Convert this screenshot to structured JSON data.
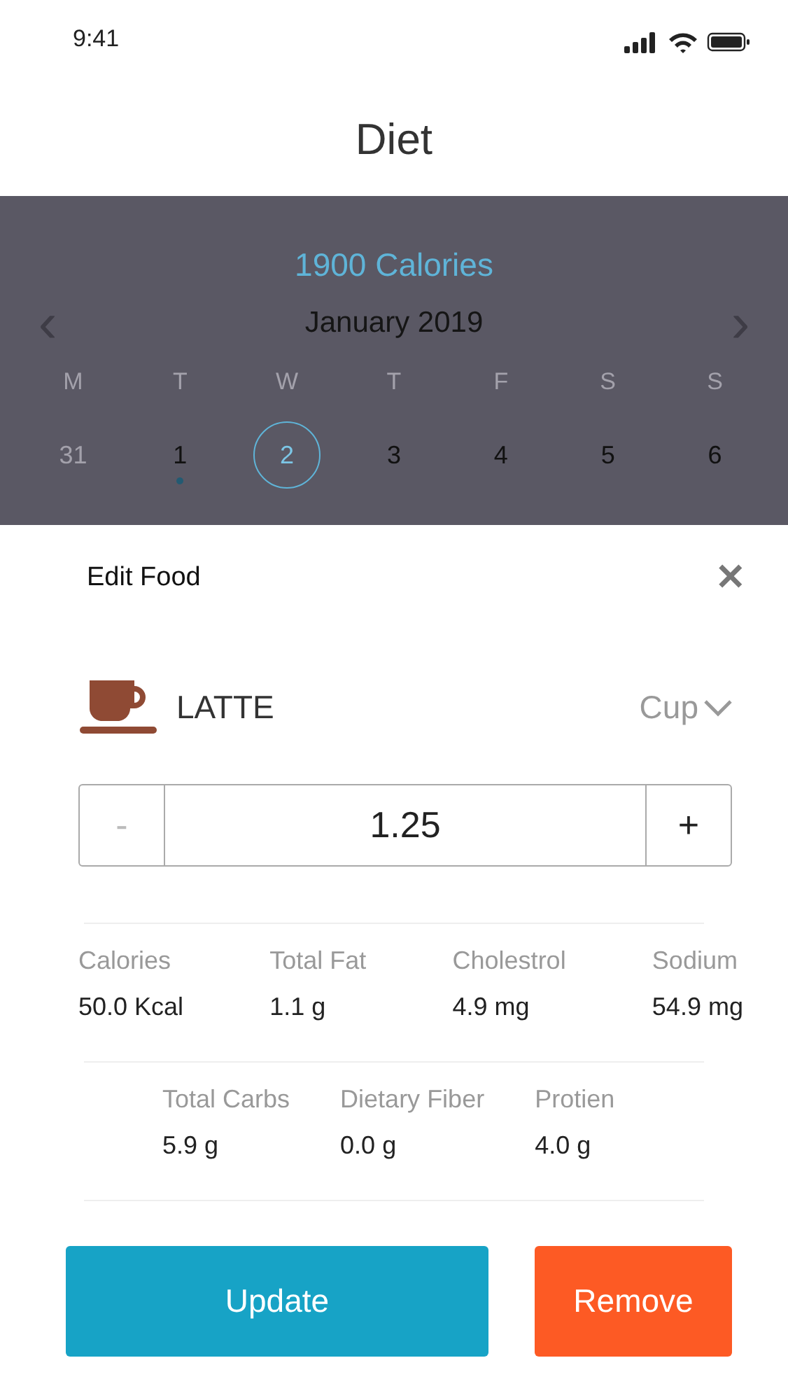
{
  "status_bar": {
    "time": "9:41"
  },
  "header": {
    "title": "Diet"
  },
  "calendar": {
    "calories": "1900 Calories",
    "month": "January 2019",
    "prev": "‹",
    "next": "›",
    "weekdays": [
      "M",
      "T",
      "W",
      "T",
      "F",
      "S",
      "S"
    ],
    "days": [
      {
        "label": "31",
        "selected": false,
        "outside_month": true,
        "has_entry": false
      },
      {
        "label": "1",
        "selected": false,
        "outside_month": false,
        "has_entry": true
      },
      {
        "label": "2",
        "selected": true,
        "outside_month": false,
        "has_entry": false
      },
      {
        "label": "3",
        "selected": false,
        "outside_month": false,
        "has_entry": false
      },
      {
        "label": "4",
        "selected": false,
        "outside_month": false,
        "has_entry": false
      },
      {
        "label": "5",
        "selected": false,
        "outside_month": false,
        "has_entry": false
      },
      {
        "label": "6",
        "selected": false,
        "outside_month": false,
        "has_entry": false
      }
    ]
  },
  "sheet": {
    "title": "Edit Food",
    "close": "✕",
    "food": {
      "name": "LATTE",
      "unit": "Cup"
    },
    "quantity": {
      "value": "1.25",
      "decrement": {
        "label": "-",
        "disabled": true
      },
      "increment": {
        "label": "+",
        "disabled": false
      }
    },
    "nutrient_rows": [
      {
        "items": [
          {
            "label": "Calories",
            "value": "50.0 Kcal"
          },
          {
            "label": "Total Fat",
            "value": "1.1 g"
          },
          {
            "label": "Cholestrol",
            "value": "4.9 mg"
          },
          {
            "label": "Sodium",
            "value": "54.9 mg"
          }
        ]
      },
      {
        "items": [
          {
            "label": "Total Carbs",
            "value": "5.9 g"
          },
          {
            "label": "Dietary Fiber",
            "value": "0.0 g"
          },
          {
            "label": "Protien",
            "value": "4.0 g"
          }
        ]
      }
    ],
    "buttons": [
      {
        "label": "Update",
        "kind": "primary"
      },
      {
        "label": "Remove",
        "kind": "danger"
      }
    ]
  }
}
